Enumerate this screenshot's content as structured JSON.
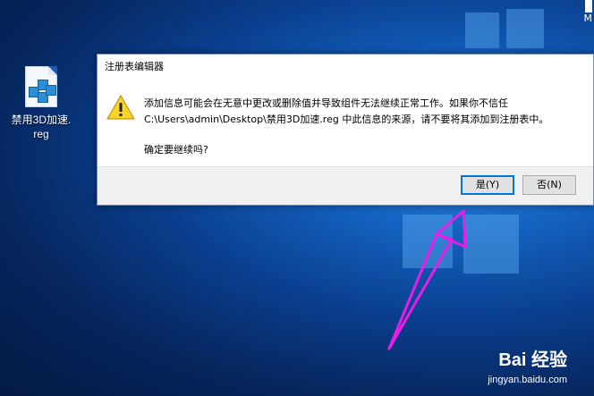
{
  "desktop": {
    "corner_letters": [
      "M"
    ],
    "icon_label_line1": "禁用3D加速.",
    "icon_label_line2": "reg"
  },
  "dialog": {
    "title": "注册表编辑器",
    "message_line1": "添加信息可能会在无意中更改或删除值并导致组件无法继续正常工作。如果你不信任",
    "message_line2": "C:\\Users\\admin\\Desktop\\禁用3D加速.reg 中此信息的来源，请不要将其添加到注册表中。",
    "confirm": "确定要继续吗?",
    "yes_label": "是(Y)",
    "no_label": "否(N)"
  },
  "watermark": {
    "brand": "Bai 经验",
    "site": "jingyan.baidu.com"
  },
  "colors": {
    "arrow": "#e81ee8",
    "default_button_border": "#0078d7",
    "warning_fill": "#f8d32a"
  }
}
